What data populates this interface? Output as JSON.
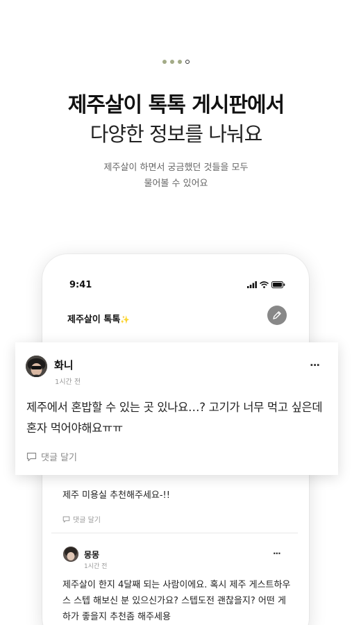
{
  "onboarding": {
    "step_total": 4,
    "step_current": 4,
    "headline": "제주살이 톡톡 게시판에서",
    "subheadline": "다양한 정보를 나눠요",
    "description_line1": "제주살이 하면서 궁금했던 것들을 모두",
    "description_line2": "물어볼 수 있어요"
  },
  "phone": {
    "status_time": "9:41",
    "app_title": "제주살이 톡톡",
    "app_title_emoji": "✨",
    "icons": [
      "signal-icon",
      "wifi-icon",
      "battery-icon",
      "pencil-icon"
    ]
  },
  "featured_post": {
    "author": "화니",
    "time": "1시간 전",
    "more": "···",
    "text": "제주에서 혼밥할 수 있는 곳 있나요…? 고기가 너무 먹고 싶은데 혼자 먹어야해요ㅠㅠ",
    "comment_label": "댓글 달기"
  },
  "post_2": {
    "text": "제주 미용실 추천해주세요-!!",
    "comment_label": "댓글 달기"
  },
  "post_3": {
    "author": "몽몽",
    "time": "1시간 전",
    "more": "···",
    "text": "제주살이 한지 4달째 되는 사람이에요. 혹시 제주 게스트하우스 스텝 해보신 분 있으신가요? 스텝도전 괜찮을지? 어떤 게하가 좋을지 추천좀 해주세용"
  },
  "colors": {
    "dot_active": "#a3ab87",
    "write_button": "#888888"
  }
}
